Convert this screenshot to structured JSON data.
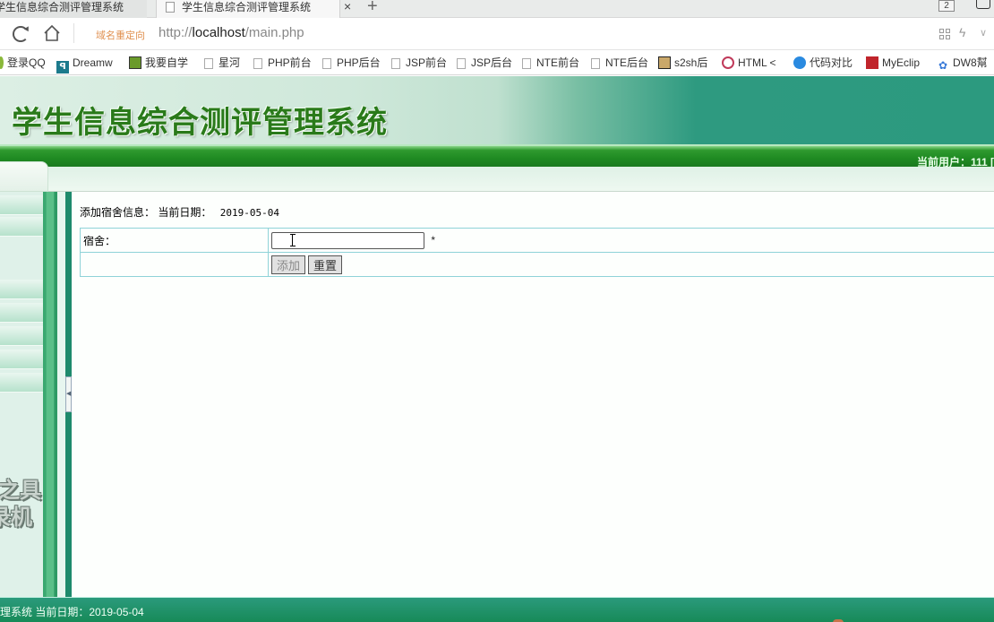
{
  "browser": {
    "tabs": [
      {
        "label": "学生信息综合测评管理系统",
        "active": false
      },
      {
        "label": "学生信息综合测评管理系统",
        "active": true
      }
    ],
    "close_glyph": "×",
    "new_tab_glyph": "+",
    "tab_count": "2",
    "redirect_label": "域名重定向",
    "url_scheme": "http://",
    "url_host": "localhost",
    "url_path": "/main.php",
    "bolt_glyph": "ϟ",
    "chevron_glyph": "∨",
    "bookmarks": [
      {
        "label": "登录QQ",
        "icon": "qq-icon"
      },
      {
        "label": "Dreamw",
        "icon": "dreamweaver-icon"
      },
      {
        "label": "我要自学",
        "icon": "vim-icon"
      },
      {
        "label": "星河",
        "icon": "page-icon"
      },
      {
        "label": "PHP前台",
        "icon": "page-icon"
      },
      {
        "label": "PHP后台",
        "icon": "page-icon"
      },
      {
        "label": "JSP前台",
        "icon": "page-icon"
      },
      {
        "label": "JSP后台",
        "icon": "page-icon"
      },
      {
        "label": "NTE前台",
        "icon": "page-icon"
      },
      {
        "label": "NTE后台",
        "icon": "page-icon"
      },
      {
        "label": "s2sh后",
        "icon": "image-icon"
      },
      {
        "label": "HTML <",
        "icon": "html-icon"
      },
      {
        "label": "代码对比",
        "icon": "compare-icon"
      },
      {
        "label": "MyEclip",
        "icon": "myeclipse-icon"
      },
      {
        "label": "DW8幫",
        "icon": "paw-icon"
      }
    ]
  },
  "app": {
    "title": "学生信息综合测评管理系统",
    "current_user_label": "当前用户：111 [",
    "watermark_line1": "之具",
    "watermark_line2": "录机",
    "collapse_glyph": "◀"
  },
  "main": {
    "section_label": "添加宿舍信息：",
    "date_label": "当前日期：",
    "date_value": "2019-05-04",
    "form": {
      "dorm_label": "宿舍：",
      "dorm_value": "",
      "required_mark": "*",
      "add_button": "添加",
      "reset_button": "重置"
    }
  },
  "footer": {
    "text": "理系统 当前日期：2019-05-04"
  }
}
